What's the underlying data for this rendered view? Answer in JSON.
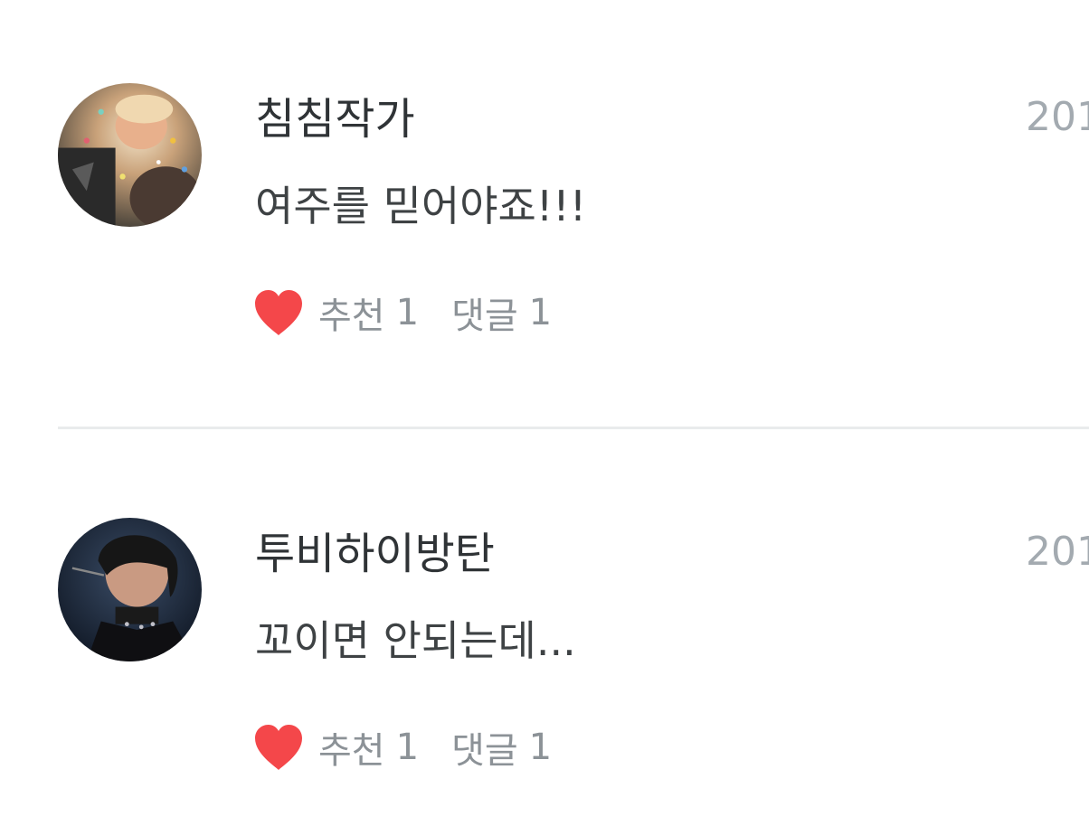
{
  "comments": [
    {
      "author": "침침작가",
      "text": "여주를 믿어야죠!!!",
      "date": "201",
      "like_label": "추천",
      "like_count": "1",
      "reply_label": "댓글",
      "reply_count": "1",
      "avatar_icon": "user-avatar-photo"
    },
    {
      "author": "투비하이방탄",
      "text": "꼬이면 안되는데...",
      "date": "201",
      "like_label": "추천",
      "like_count": "1",
      "reply_label": "댓글",
      "reply_count": "1",
      "avatar_icon": "user-avatar-photo"
    }
  ],
  "icons": {
    "like": "heart-icon"
  },
  "colors": {
    "heart": "#f4474a",
    "author_text": "#2f3336",
    "body_text": "#3e4244",
    "meta_text": "#8c9297",
    "date_text": "#a3aab0",
    "divider": "#e9ebec"
  }
}
